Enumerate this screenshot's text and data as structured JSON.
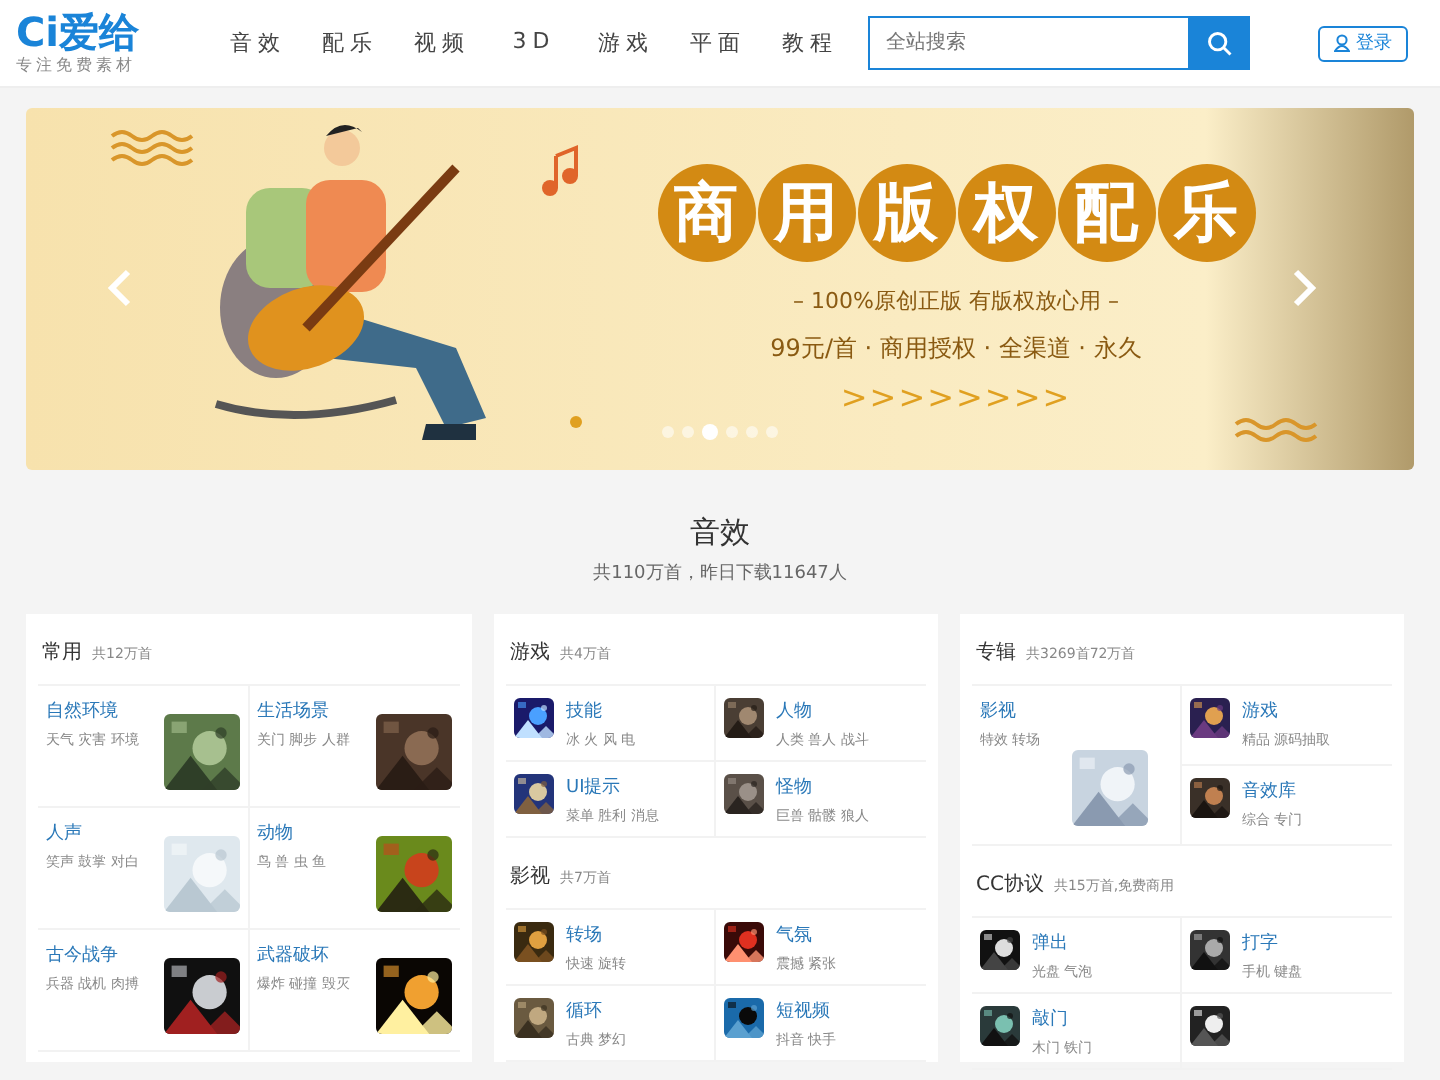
{
  "header": {
    "logo": "Ci爱给",
    "tagline": "专注免费素材",
    "nav": [
      {
        "label": "音效",
        "selected": false
      },
      {
        "label": "配乐",
        "selected": false
      },
      {
        "label": "视频",
        "selected": false
      },
      {
        "label": "3D",
        "selected": false
      },
      {
        "label": "游戏",
        "selected": false
      },
      {
        "label": "平面",
        "selected": false
      },
      {
        "label": "教程",
        "selected": false
      }
    ],
    "search": {
      "placeholder": "全站搜索"
    },
    "login": "登录"
  },
  "banner": {
    "headline": [
      "商",
      "用",
      "版",
      "权",
      "配",
      "乐"
    ],
    "line1": "– 100%原创正版 有版权放心用 –",
    "line2": "99元/首 · 商用授权 · 全渠道 · 永久",
    "chevrons": ">>>>>>>>",
    "dots": [
      {
        "selected": false
      },
      {
        "selected": false
      },
      {
        "selected": true
      },
      {
        "selected": false
      },
      {
        "selected": false
      },
      {
        "selected": false
      }
    ]
  },
  "section": {
    "title": "音效",
    "subtitle": "共110万首，昨日下载11647人"
  },
  "cards": [
    {
      "groups": [
        {
          "title": "常用",
          "count": "共12万首",
          "kind": "thumb-right",
          "tiles": [
            {
              "title": "自然环境",
              "tags": "天气 灾害 环境"
            },
            {
              "title": "生活场景",
              "tags": "关门 脚步 人群"
            },
            {
              "title": "人声",
              "tags": "笑声 鼓掌 对白"
            },
            {
              "title": "动物",
              "tags": "鸟 兽 虫 鱼"
            },
            {
              "title": "古今战争",
              "tags": "兵器 战机 肉搏"
            },
            {
              "title": "武器破坏",
              "tags": "爆炸 碰撞 毁灭"
            }
          ]
        }
      ]
    },
    {
      "groups": [
        {
          "title": "游戏",
          "count": "共4万首",
          "kind": "icon-left",
          "tiles": [
            {
              "title": "技能",
              "tags": "冰 火 风 电"
            },
            {
              "title": "人物",
              "tags": "人类 兽人 战斗"
            },
            {
              "title": "UI提示",
              "tags": "菜单 胜利 消息"
            },
            {
              "title": "怪物",
              "tags": "巨兽 骷髅 狼人"
            }
          ]
        },
        {
          "title": "影视",
          "count": "共7万首",
          "kind": "icon-left",
          "tiles": [
            {
              "title": "转场",
              "tags": "快速 旋转"
            },
            {
              "title": "气氛",
              "tags": "震撼 紧张"
            },
            {
              "title": "循环",
              "tags": "古典 梦幻"
            },
            {
              "title": "短视频",
              "tags": "抖音 快手"
            }
          ]
        }
      ]
    },
    {
      "groups": [
        {
          "title": "专辑",
          "count": "共3269首72万首",
          "kind": "feature",
          "tiles": [
            {
              "title": "影视",
              "tags": "特效 转场"
            },
            {
              "title": "游戏",
              "tags": "精品 源码抽取"
            },
            {
              "title": "音效库",
              "tags": "综合 专门"
            }
          ]
        },
        {
          "title": "CC协议",
          "count": "共15万首,免费商用",
          "kind": "icon-left",
          "tiles": [
            {
              "title": "弹出",
              "tags": "光盘 气泡"
            },
            {
              "title": "打字",
              "tags": "手机 键盘"
            },
            {
              "title": "敲门",
              "tags": "木门 铁门"
            },
            {
              "kind": "picture"
            }
          ]
        }
      ]
    }
  ]
}
